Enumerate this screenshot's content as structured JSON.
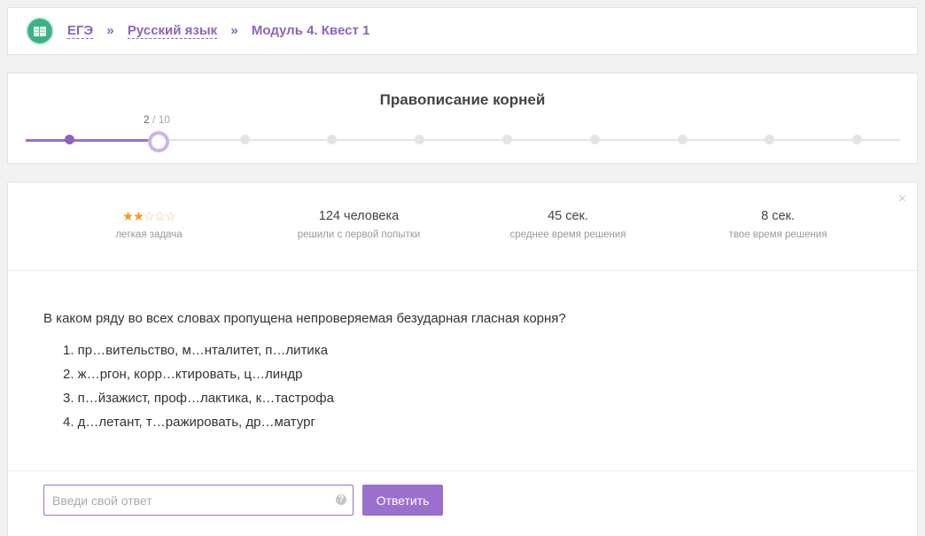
{
  "breadcrumb": {
    "items": [
      "ЕГЭ",
      "Русский язык"
    ],
    "separator": "»",
    "current": "Модуль 4. Квест 1"
  },
  "progress": {
    "title": "Правописание корней",
    "current": "2",
    "total_text": " / 10",
    "current_step": 2,
    "total_steps": 10
  },
  "stats": {
    "difficulty": {
      "stars_filled": "★★",
      "stars_empty": "☆☆☆",
      "rating": 2,
      "max": 5,
      "label": "легкая задача"
    },
    "solved": {
      "value": "124 человека",
      "label": "решили с первой попытки"
    },
    "avg_time": {
      "value": "45 сек.",
      "label": "среднее время решения"
    },
    "your_time": {
      "value": "8 сек.",
      "label": "твое время решения"
    }
  },
  "task": {
    "question": "В каком ряду во всех словах пропущена непроверяемая безударная гласная корня?",
    "options": [
      "1. пр…вительство, м…нталитет, п…литика",
      "2. ж…ргон, корр…ктировать, ц…линдр",
      "3. п…йзажист, проф…лактика, к…тастрофа",
      "4. д…летант, т…ражировать, др…матург"
    ]
  },
  "answer": {
    "value": "",
    "placeholder": "Введи свой ответ",
    "help_symbol": "?",
    "submit_label": "Ответить"
  },
  "icons": {
    "close": "×"
  },
  "colors": {
    "accent": "#9b6fce",
    "star": "#f29b1d",
    "logo": "#3cb387"
  }
}
